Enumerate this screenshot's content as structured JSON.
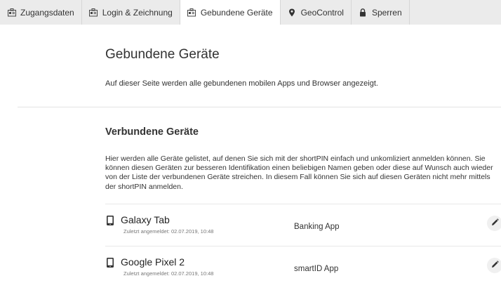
{
  "tabs": [
    {
      "label": "Zugangsdaten",
      "icon": "id-card-icon",
      "active": false
    },
    {
      "label": "Login & Zeichnung",
      "icon": "id-card-icon",
      "active": false
    },
    {
      "label": "Gebundene Geräte",
      "icon": "id-card-icon",
      "active": true
    },
    {
      "label": "GeoControl",
      "icon": "map-pin-icon",
      "active": false
    },
    {
      "label": "Sperren",
      "icon": "lock-icon",
      "active": false
    }
  ],
  "page": {
    "title": "Gebundene Geräte",
    "description": "Auf dieser Seite werden alle gebundenen mobilen Apps und Browser angezeigt."
  },
  "section": {
    "title": "Verbundene Geräte",
    "description": "Hier werden alle Geräte gelistet, auf denen Sie sich mit der shortPIN einfach und unkomliziert anmelden können. Sie können diesen Geräten zur besseren Identifikation einen beliebigen Namen geben oder diese auf Wunsch auch wieder von der Liste der verbundenen Geräte streichen. In diesem Fall können Sie sich auf diesen Geräten nicht mehr mittels der shortPIN anmelden."
  },
  "devices": [
    {
      "name": "Galaxy Tab",
      "last_login": "Zuletzt angemeldet: 02.07.2019, 10:48",
      "app": "Banking App",
      "icon": "smartphone-icon",
      "action_icon": "pencil-icon"
    },
    {
      "name": "Google Pixel 2",
      "last_login": "Zuletzt angemeldet: 02.07.2019, 10:48",
      "app": "smartID App",
      "icon": "smartphone-icon",
      "action_icon": "pencil-icon"
    }
  ],
  "colors": {
    "tabbar_bg": "#ebebeb",
    "active_tab_bg": "#ffffff",
    "text": "#333333",
    "muted_text": "#777777"
  }
}
